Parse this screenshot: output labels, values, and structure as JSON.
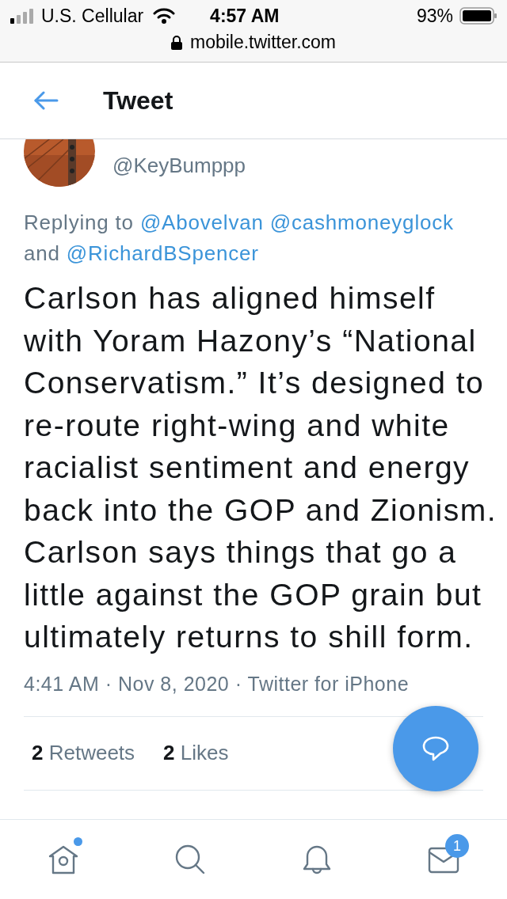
{
  "status_bar": {
    "carrier": "U.S. Cellular",
    "time": "4:57 AM",
    "battery": "93%",
    "url": "mobile.twitter.com"
  },
  "header": {
    "title": "Tweet"
  },
  "tweet": {
    "handle": "@KeyBumppp",
    "replying_label": "Replying to",
    "replying_to": [
      "@Abovelvan",
      "@cashmoneyglock"
    ],
    "replying_joiner": "and",
    "replying_last": "@RichardBSpencer",
    "text": "Carlson has aligned himself with Yoram Hazony’s “National Conservatism.” It’s designed to re-route right-wing and white racialist sentiment and energy back into the GOP and Zionism. Carlson says things that go a little against the GOP grain but ultimately returns to shill form.",
    "meta": "4:41 AM · Nov 8, 2020 · Twitter for iPhone",
    "stats": [
      {
        "count": "2",
        "label": "Retweets"
      },
      {
        "count": "2",
        "label": "Likes"
      }
    ]
  },
  "tab_bar": [
    {
      "kind": "home",
      "dot": true
    },
    {
      "kind": "search"
    },
    {
      "kind": "notifications"
    },
    {
      "kind": "messages",
      "badge": "1"
    }
  ]
}
